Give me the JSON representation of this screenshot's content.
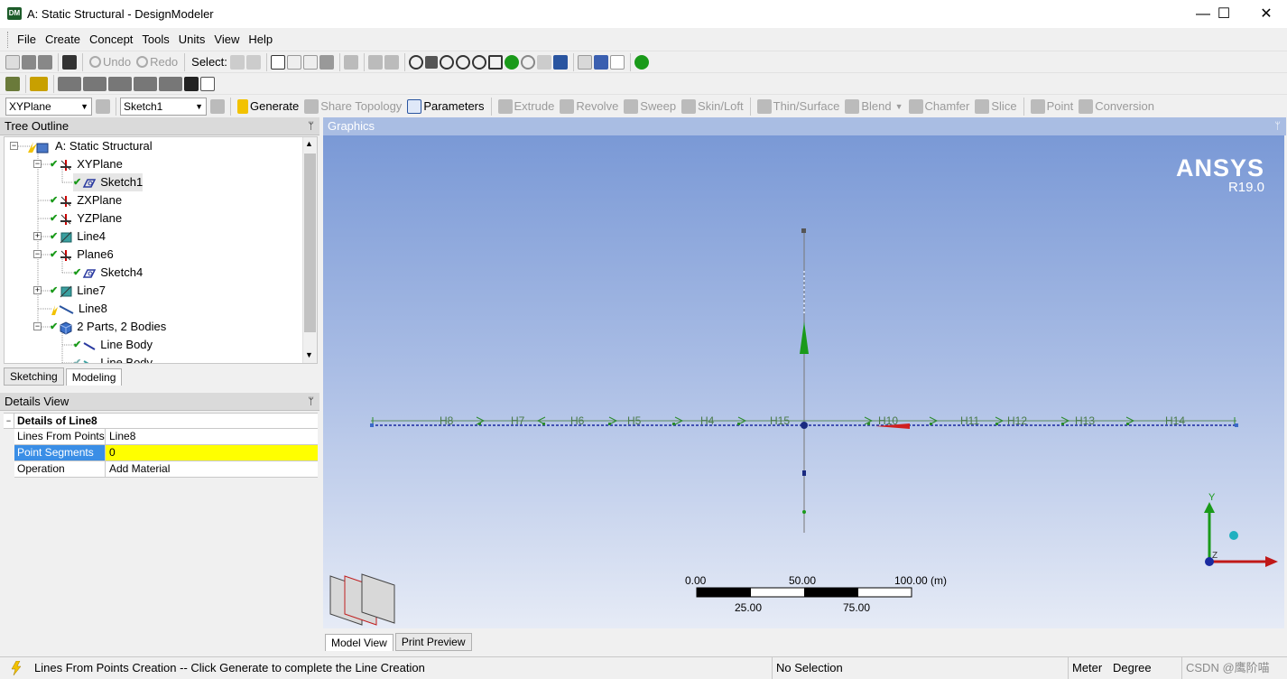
{
  "window": {
    "app_icon_text": "DM",
    "title": "A: Static Structural - DesignModeler",
    "minimize": "—",
    "maximize": "☐",
    "close": "✕"
  },
  "menu": [
    "File",
    "Create",
    "Concept",
    "Tools",
    "Units",
    "View",
    "Help"
  ],
  "toolbar1": {
    "undo": "Undo",
    "redo": "Redo",
    "select_label": "Select:"
  },
  "toolbar3": {
    "plane_select": "XYPlane",
    "sketch_select": "Sketch1",
    "generate": "Generate",
    "share_topology": "Share Topology",
    "parameters": "Parameters",
    "extrude": "Extrude",
    "revolve": "Revolve",
    "sweep": "Sweep",
    "skin_loft": "Skin/Loft",
    "thin_surface": "Thin/Surface",
    "blend": "Blend",
    "chamfer": "Chamfer",
    "slice": "Slice",
    "point": "Point",
    "conversion": "Conversion"
  },
  "tree_outline": {
    "header": "Tree Outline",
    "pin": "ᛘ",
    "items": [
      {
        "label": "A: Static Structural"
      },
      {
        "label": "XYPlane"
      },
      {
        "label": "Sketch1"
      },
      {
        "label": "ZXPlane"
      },
      {
        "label": "YZPlane"
      },
      {
        "label": "Line4"
      },
      {
        "label": "Plane6"
      },
      {
        "label": "Sketch4"
      },
      {
        "label": "Line7"
      },
      {
        "label": "Line8"
      },
      {
        "label": "2 Parts, 2 Bodies"
      },
      {
        "label": "Line Body"
      },
      {
        "label": "Line Body"
      }
    ],
    "tabs": [
      "Sketching",
      "Modeling"
    ]
  },
  "details_view": {
    "header": "Details View",
    "title": "Details of Line8",
    "rows": [
      {
        "name": "Lines From Points",
        "value": "Line8"
      },
      {
        "name": "Point Segments",
        "value": "0"
      },
      {
        "name": "Operation",
        "value": "Add Material"
      }
    ]
  },
  "graphics": {
    "header": "Graphics",
    "brand": "ANSYS",
    "version": "R19.0",
    "segment_labels": [
      "H8",
      "H7",
      "H6",
      "H5",
      "H4",
      "H15",
      "H10",
      "H11",
      "H12",
      "H13",
      "H14"
    ],
    "scale_top": [
      "0.00",
      "50.00",
      "100.00 (m)"
    ],
    "scale_bottom": [
      "25.00",
      "75.00"
    ],
    "axis_y": "Y",
    "axis_z": "Z",
    "tabs": [
      "Model View",
      "Print Preview"
    ]
  },
  "status": {
    "message": "Lines From Points Creation -- Click Generate to complete the Line Creation",
    "selection": "No Selection",
    "unit_length": "Meter",
    "unit_angle": "Degree",
    "watermark": "CSDN @鹰阶喵"
  },
  "colors": {
    "graphics_top": "#7a99d6",
    "selection_yellow": "#ffff00",
    "highlight_blue": "#3a8ee6"
  }
}
